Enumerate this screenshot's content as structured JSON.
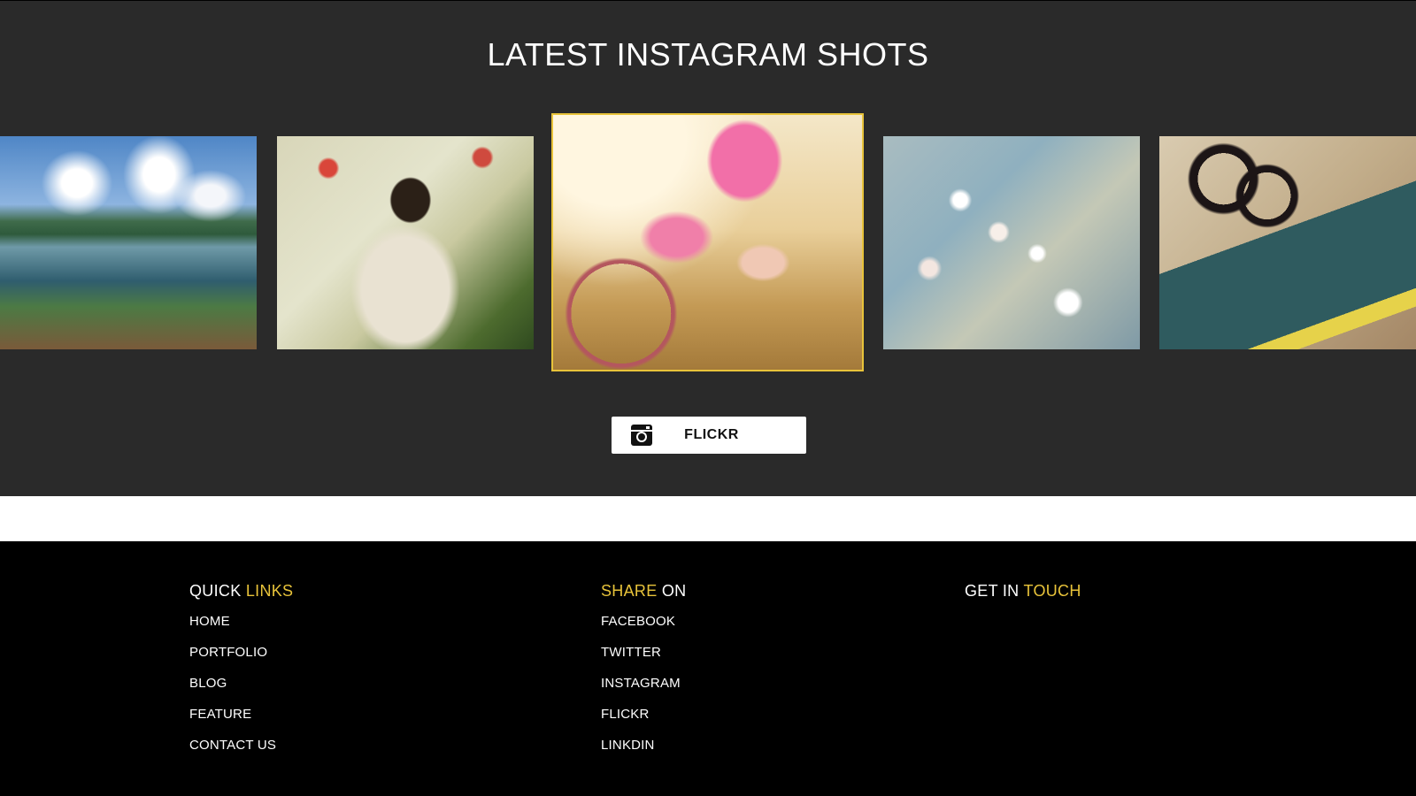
{
  "instagram": {
    "title": "LATEST INSTAGRAM SHOTS",
    "button_label": "FLICKR",
    "button_icon": "instagram-icon"
  },
  "footer": {
    "quick_links": {
      "heading_plain": "QUICK",
      "heading_accent": "LINKS",
      "items": [
        "HOME",
        "PORTFOLIO",
        "BLOG",
        "FEATURE",
        "CONTACT US"
      ]
    },
    "share_on": {
      "heading_accent": "SHARE",
      "heading_plain": "ON",
      "items": [
        "FACEBOOK",
        "TWITTER",
        "INSTAGRAM",
        "FLICKR",
        "LINKDIN"
      ]
    },
    "get_in_touch": {
      "heading_plain": "GET IN",
      "heading_accent": "TOUCH"
    }
  },
  "colors": {
    "accent": "#e8c33a",
    "section_bg": "#2a2a2a",
    "footer_bg": "#000000"
  }
}
